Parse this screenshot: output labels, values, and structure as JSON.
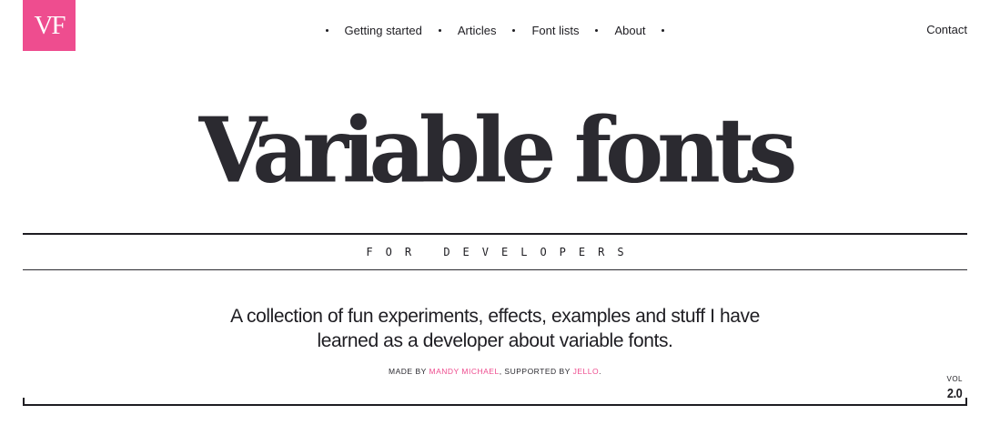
{
  "logo": {
    "text": "VF",
    "color": "#ee4d8f"
  },
  "nav": {
    "items": [
      {
        "label": "Getting started"
      },
      {
        "label": "Articles"
      },
      {
        "label": "Font lists"
      },
      {
        "label": "About"
      }
    ],
    "contact": "Contact"
  },
  "hero": {
    "title": "Variable fonts",
    "subtitle": "FOR DEVELOPERS"
  },
  "intro": {
    "line1": "A collection of fun experiments, effects, examples and stuff I have",
    "line2": "learned as a developer about variable fonts."
  },
  "credits": {
    "made_by": "MADE BY ",
    "author": "MANDY MICHAEL",
    "supported_by": ", SUPPORTED BY ",
    "sponsor": "JELLO",
    "end": "."
  },
  "volume": {
    "label": "VOL",
    "number": "2.0"
  },
  "colors": {
    "accent": "#ee4d8f",
    "text": "#2b2a30"
  }
}
